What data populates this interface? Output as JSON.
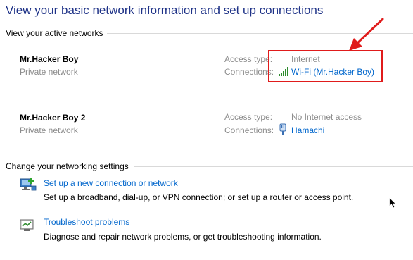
{
  "header": {
    "title": "View your basic network information and set up connections"
  },
  "active_networks": {
    "heading": "View your active networks",
    "networks": [
      {
        "name": "Mr.Hacker Boy",
        "type": "Private network",
        "access_type_label": "Access type:",
        "access_type_value": "Internet",
        "connections_label": "Connections:",
        "connection_link": "Wi-Fi (Mr.Hacker Boy)",
        "connection_icon": "wifi-signal-icon"
      },
      {
        "name": "Mr.Hacker Boy 2",
        "type": "Private network",
        "access_type_label": "Access type:",
        "access_type_value": "No Internet access",
        "connections_label": "Connections:",
        "connection_link": "Hamachi",
        "connection_icon": "ethernet-plug-icon"
      }
    ]
  },
  "settings": {
    "heading": "Change your networking settings",
    "items": [
      {
        "link": "Set up a new connection or network",
        "description": "Set up a broadband, dial-up, or VPN connection; or set up a router or access point.",
        "icon": "new-connection-icon"
      },
      {
        "link": "Troubleshoot problems",
        "description": "Diagnose and repair network problems, or get troubleshooting information.",
        "icon": "troubleshoot-icon"
      }
    ]
  },
  "colors": {
    "title": "#1e3287",
    "link": "#0066cc",
    "muted": "#8c8c8c",
    "annotation": "#e01b1b"
  }
}
